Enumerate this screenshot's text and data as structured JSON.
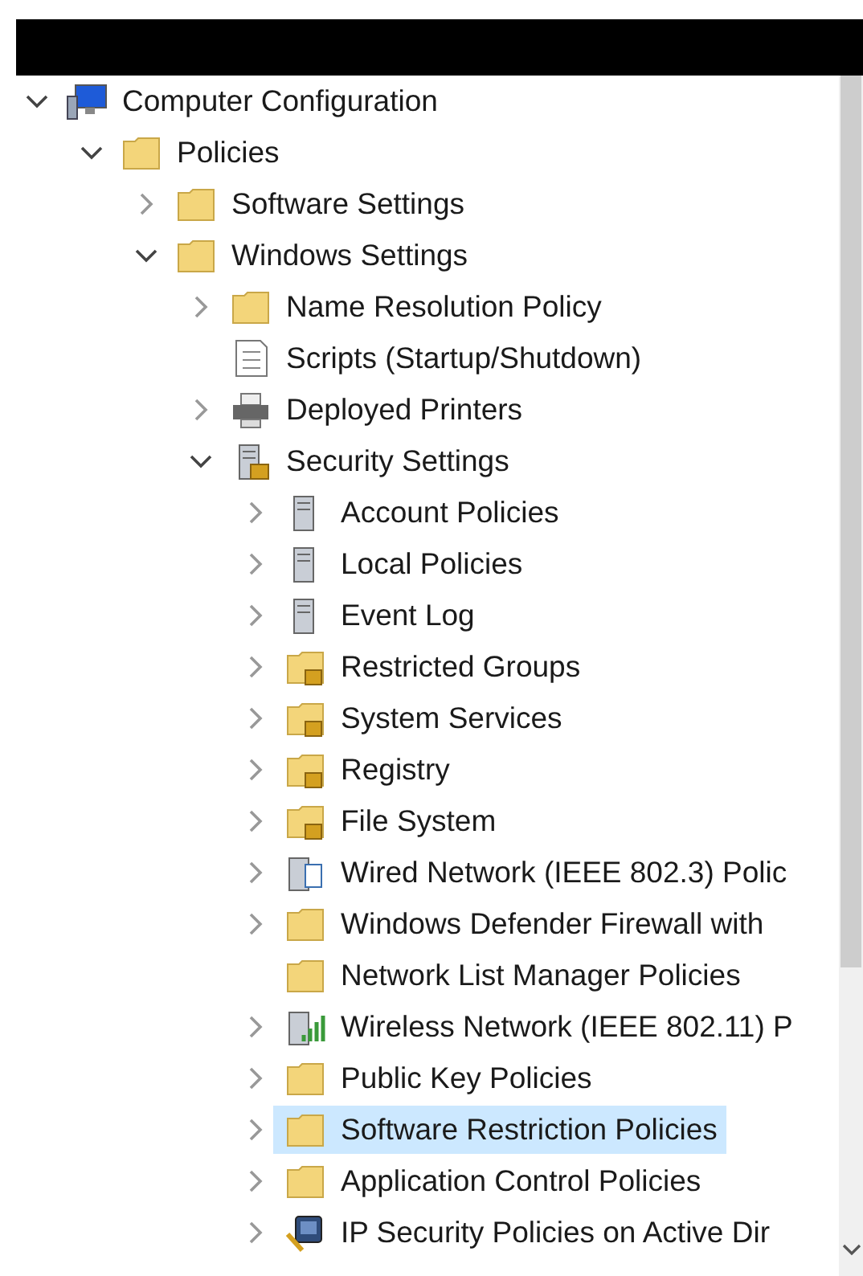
{
  "tree": [
    {
      "label": "Computer Configuration",
      "kind": "computer",
      "expandable": true,
      "expanded": true,
      "selected": false,
      "children": [
        {
          "label": "Policies",
          "kind": "folder",
          "expandable": true,
          "expanded": true,
          "selected": false,
          "children": [
            {
              "label": "Software Settings",
              "kind": "folder",
              "expandable": true,
              "expanded": false,
              "selected": false
            },
            {
              "label": "Windows Settings",
              "kind": "folder",
              "expandable": true,
              "expanded": true,
              "selected": false,
              "children": [
                {
                  "label": "Name Resolution Policy",
                  "kind": "folder",
                  "expandable": true,
                  "expanded": false,
                  "selected": false
                },
                {
                  "label": "Scripts (Startup/Shutdown)",
                  "kind": "script",
                  "expandable": false,
                  "selected": false
                },
                {
                  "label": "Deployed Printers",
                  "kind": "printer",
                  "expandable": true,
                  "expanded": false,
                  "selected": false
                },
                {
                  "label": "Security Settings",
                  "kind": "security",
                  "expandable": true,
                  "expanded": true,
                  "selected": false,
                  "children": [
                    {
                      "label": "Account Policies",
                      "kind": "policy",
                      "expandable": true,
                      "expanded": false,
                      "selected": false
                    },
                    {
                      "label": "Local Policies",
                      "kind": "policy",
                      "expandable": true,
                      "expanded": false,
                      "selected": false
                    },
                    {
                      "label": "Event Log",
                      "kind": "policy",
                      "expandable": true,
                      "expanded": false,
                      "selected": false
                    },
                    {
                      "label": "Restricted Groups",
                      "kind": "locked-folder",
                      "expandable": true,
                      "expanded": false,
                      "selected": false
                    },
                    {
                      "label": "System Services",
                      "kind": "locked-folder",
                      "expandable": true,
                      "expanded": false,
                      "selected": false
                    },
                    {
                      "label": "Registry",
                      "kind": "locked-folder",
                      "expandable": true,
                      "expanded": false,
                      "selected": false
                    },
                    {
                      "label": "File System",
                      "kind": "locked-folder",
                      "expandable": true,
                      "expanded": false,
                      "selected": false
                    },
                    {
                      "label": "Wired Network (IEEE 802.3) Polic",
                      "kind": "wired",
                      "expandable": true,
                      "expanded": false,
                      "selected": false
                    },
                    {
                      "label": "Windows Defender Firewall with",
                      "kind": "folder",
                      "expandable": true,
                      "expanded": false,
                      "selected": false
                    },
                    {
                      "label": "Network List Manager Policies",
                      "kind": "folder",
                      "expandable": false,
                      "selected": false
                    },
                    {
                      "label": "Wireless Network (IEEE 802.11) P",
                      "kind": "wireless",
                      "expandable": true,
                      "expanded": false,
                      "selected": false
                    },
                    {
                      "label": "Public Key Policies",
                      "kind": "folder",
                      "expandable": true,
                      "expanded": false,
                      "selected": false
                    },
                    {
                      "label": "Software Restriction Policies",
                      "kind": "folder",
                      "expandable": true,
                      "expanded": false,
                      "selected": true
                    },
                    {
                      "label": "Application Control Policies",
                      "kind": "folder",
                      "expandable": true,
                      "expanded": false,
                      "selected": false
                    },
                    {
                      "label": "IP Security Policies on Active Dir",
                      "kind": "ipsec",
                      "expandable": true,
                      "expanded": false,
                      "selected": false
                    }
                  ]
                }
              ]
            }
          ]
        }
      ]
    }
  ]
}
